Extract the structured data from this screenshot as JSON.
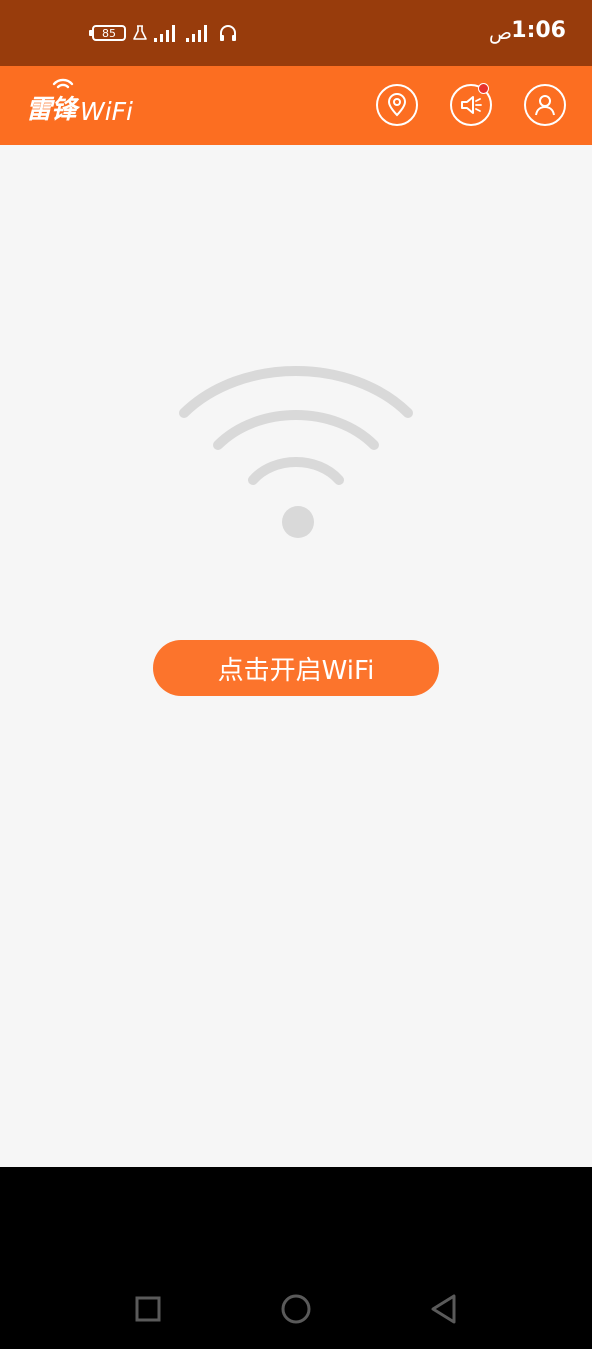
{
  "status_bar": {
    "battery_level": "85",
    "time": "1:06",
    "ampm": "ص",
    "icons": [
      "battery-icon",
      "flask-icon",
      "signal-icon",
      "signal-icon",
      "headphones-icon"
    ]
  },
  "header": {
    "logo_mark": "雷锋",
    "logo_text": "WiFi",
    "actions": [
      "location-pin-icon",
      "speaker-icon",
      "user-profile-icon"
    ],
    "has_notification": true
  },
  "main": {
    "graphic": "wifi-icon",
    "open_wifi_label": "点击开启WiFi"
  },
  "nav": {
    "buttons": [
      "recents-square-icon",
      "home-circle-icon",
      "back-triangle-icon"
    ]
  },
  "colors": {
    "status_bar": "#983c0c",
    "header": "#fc6e21",
    "button": "#fc742c",
    "background": "#f6f6f6",
    "wifi_graphic": "#d9d9d9",
    "notification": "#e8322b"
  }
}
